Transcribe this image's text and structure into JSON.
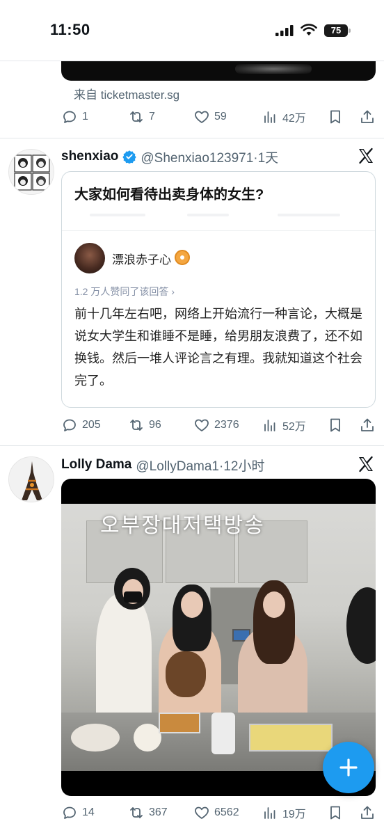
{
  "status_bar": {
    "time": "11:50",
    "battery": "75"
  },
  "colors": {
    "accent": "#1d9bf0",
    "text_secondary": "#536471",
    "divider": "#e3e7ea"
  },
  "tweets": [
    {
      "source": "来自 ticketmaster.sg",
      "actions": {
        "replies": "1",
        "retweets": "7",
        "likes": "59",
        "views": "42万"
      }
    },
    {
      "display_name": "shenxiao",
      "handle_time": "@Shenxiao123971·1天",
      "verified": true,
      "quote": {
        "question": "大家如何看待出卖身体的女生?",
        "author": "漂浪赤子心",
        "meta": "1.2 万人赞同了该回答 ›",
        "body": "前十几年左右吧，网络上开始流行一种言论，大概是说女大学生和谁睡不是睡，给男朋友浪费了，还不如换钱。然后一堆人评论言之有理。我就知道这个社会完了。"
      },
      "actions": {
        "replies": "205",
        "retweets": "96",
        "likes": "2376",
        "views": "52万"
      }
    },
    {
      "display_name": "Lolly Dama",
      "handle_time": "@LollyDama1·12小时",
      "video_caption": "오부장대저택방송",
      "actions": {
        "replies": "14",
        "retweets": "367",
        "likes": "6562",
        "views": "19万"
      }
    }
  ],
  "icons": [
    "reply-icon",
    "retweet-icon",
    "like-icon",
    "views-icon",
    "bookmark-icon",
    "share-icon",
    "x-logo-icon",
    "verified-icon",
    "compose-plus-icon"
  ]
}
